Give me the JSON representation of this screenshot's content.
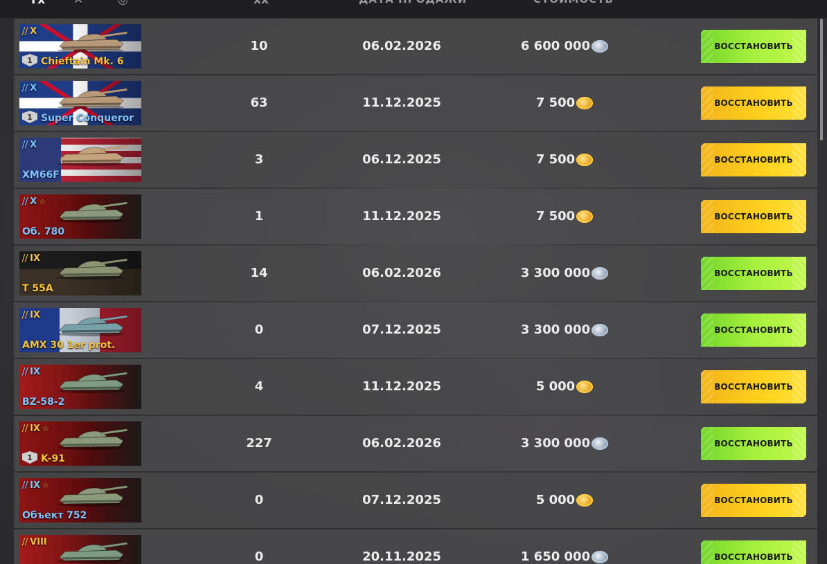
{
  "header": {
    "col_tier": "Yx",
    "col_battles_icon": "crossed-swords-icon",
    "col_nation_icon": "globe-icon",
    "col_battles_top": "xx",
    "col_date": "ДАТА ПРОДАЖИ",
    "col_cost": "СТОИМОСТЬ"
  },
  "restore_label": "ВОССТАНОВИТЬ",
  "colors": {
    "green_button": "#a6f03e",
    "gold_button": "#ffd21e",
    "gold_name": "#f6c23c",
    "blue_name": "#7fc4ff"
  },
  "rows": [
    {
      "tier": "X",
      "name": "Chieftain Mk. 6",
      "name_color": "gold",
      "flag": "gb",
      "mastery": "1",
      "premium": false,
      "battles": "10",
      "date": "06.02.2026",
      "price": "6 600 000",
      "currency": "silver-coin-icon"
    },
    {
      "tier": "X",
      "name": "Super Conqueror",
      "name_color": "blue",
      "flag": "gb",
      "mastery": "1",
      "premium": false,
      "battles": "63",
      "date": "11.12.2025",
      "price": "7 500",
      "currency": "gold-coin-icon"
    },
    {
      "tier": "X",
      "name": "XM66F",
      "name_color": "blue",
      "flag": "us",
      "mastery": "",
      "premium": false,
      "battles": "3",
      "date": "06.12.2025",
      "price": "7 500",
      "currency": "gold-coin-icon"
    },
    {
      "tier": "X",
      "name": "Об. 780",
      "name_color": "blue",
      "flag": "su",
      "mastery": "",
      "premium": true,
      "battles": "1",
      "date": "11.12.2025",
      "price": "7 500",
      "currency": "gold-coin-icon"
    },
    {
      "tier": "IX",
      "name": "T 55A",
      "name_color": "gold",
      "flag": "de",
      "mastery": "",
      "premium": false,
      "battles": "14",
      "date": "06.02.2026",
      "price": "3 300 000",
      "currency": "silver-coin-icon"
    },
    {
      "tier": "IX",
      "name": "AMX 30 1er prot.",
      "name_color": "gold",
      "flag": "fr",
      "mastery": "",
      "premium": false,
      "battles": "0",
      "date": "07.12.2025",
      "price": "3 300 000",
      "currency": "silver-coin-icon"
    },
    {
      "tier": "IX",
      "name": "BZ-58-2",
      "name_color": "blue",
      "flag": "cn",
      "mastery": "",
      "premium": false,
      "battles": "4",
      "date": "11.12.2025",
      "price": "5 000",
      "currency": "gold-coin-icon"
    },
    {
      "tier": "IX",
      "name": "K-91",
      "name_color": "gold",
      "flag": "su",
      "mastery": "1",
      "premium": true,
      "battles": "227",
      "date": "06.02.2026",
      "price": "3 300 000",
      "currency": "silver-coin-icon"
    },
    {
      "tier": "IX",
      "name": "Объект 752",
      "name_color": "blue",
      "flag": "su",
      "mastery": "",
      "premium": true,
      "battles": "0",
      "date": "07.12.2025",
      "price": "5 000",
      "currency": "gold-coin-icon"
    },
    {
      "tier": "VIII",
      "name": "",
      "name_color": "gold",
      "flag": "cn",
      "mastery": "",
      "premium": false,
      "battles": "0",
      "date": "20.11.2025",
      "price": "1 650 000",
      "currency": "silver-coin-icon"
    }
  ]
}
